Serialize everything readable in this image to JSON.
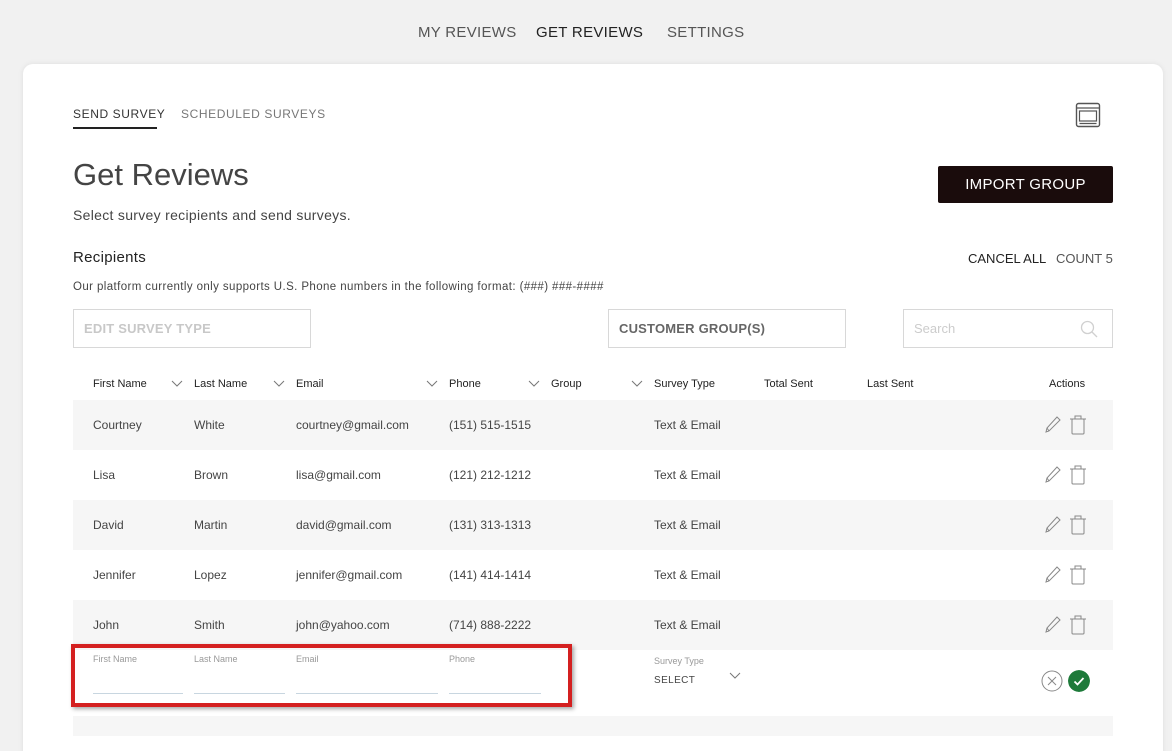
{
  "topnav": {
    "items": [
      {
        "label": "MY REVIEWS"
      },
      {
        "label": "GET REVIEWS"
      },
      {
        "label": "SETTINGS"
      }
    ]
  },
  "subtabs": [
    {
      "label": "SEND SURVEY"
    },
    {
      "label": "SCHEDULED SURVEYS"
    }
  ],
  "page": {
    "title": "Get Reviews",
    "subtitle": "Select survey recipients and send surveys.",
    "import_button": "IMPORT GROUP"
  },
  "recipients": {
    "heading": "Recipients",
    "cancel_all": "CANCEL ALL",
    "count": "COUNT 5",
    "notice": "Our platform currently only supports U.S. Phone numbers in the following format: (###) ###-####"
  },
  "filters": {
    "survey_type_placeholder": "EDIT SURVEY TYPE",
    "customer_groups_placeholder": "CUSTOMER GROUP(S)",
    "search_placeholder": "Search"
  },
  "table": {
    "headers": {
      "first_name": "First Name",
      "last_name": "Last Name",
      "email": "Email",
      "phone": "Phone",
      "group": "Group",
      "survey_type": "Survey Type",
      "total_sent": "Total Sent",
      "last_sent": "Last Sent",
      "actions": "Actions"
    },
    "rows": [
      {
        "first": "Courtney",
        "last": "White",
        "email": "courtney@gmail.com",
        "phone": "(151) 515-1515",
        "group": "",
        "survey_type": "Text & Email",
        "total_sent": "",
        "last_sent": ""
      },
      {
        "first": "Lisa",
        "last": "Brown",
        "email": "lisa@gmail.com",
        "phone": "(121) 212-1212",
        "group": "",
        "survey_type": "Text & Email",
        "total_sent": "",
        "last_sent": ""
      },
      {
        "first": "David",
        "last": "Martin",
        "email": "david@gmail.com",
        "phone": "(131) 313-1313",
        "group": "",
        "survey_type": "Text & Email",
        "total_sent": "",
        "last_sent": ""
      },
      {
        "first": "Jennifer",
        "last": "Lopez",
        "email": "jennifer@gmail.com",
        "phone": "(141) 414-1414",
        "group": "",
        "survey_type": "Text & Email",
        "total_sent": "",
        "last_sent": ""
      },
      {
        "first": "John",
        "last": "Smith",
        "email": "john@yahoo.com",
        "phone": "(714) 888-2222",
        "group": "",
        "survey_type": "Text & Email",
        "total_sent": "",
        "last_sent": ""
      }
    ]
  },
  "new_row": {
    "first_name_label": "First Name",
    "last_name_label": "Last Name",
    "email_label": "Email",
    "phone_label": "Phone",
    "survey_type_label": "Survey Type",
    "survey_type_value": "SELECT"
  },
  "colors": {
    "accent_dark": "#1a0c0c",
    "confirm_green": "#1e7a3a",
    "highlight_red": "#d42020"
  }
}
